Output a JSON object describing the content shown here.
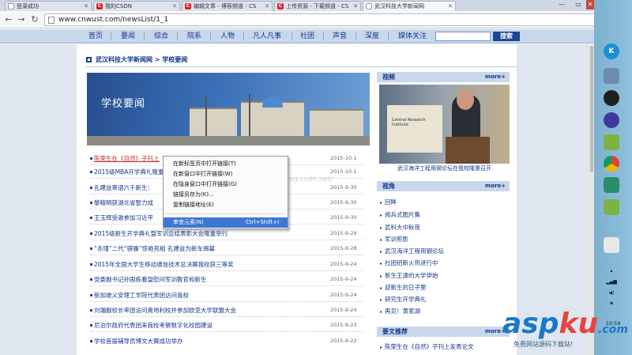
{
  "browser": {
    "tabs": [
      {
        "label": "登录成功",
        "icon": "page-icon"
      },
      {
        "label": "我的CSDN",
        "icon": "csdn-icon"
      },
      {
        "label": "编辑文章 - 博客频道 - CS",
        "icon": "csdn-icon"
      },
      {
        "label": "上传资源 - 下载频道 - CS",
        "icon": "csdn-icon"
      },
      {
        "label": "武汉科技大学新闻网",
        "icon": "page-icon"
      }
    ],
    "active_tab_index": 4,
    "window_buttons": {
      "minimize": "—",
      "maximize": "▭",
      "close": "✕"
    },
    "url": "www.cnwust.com/newsList/1_1"
  },
  "site_nav": {
    "items": [
      "首页",
      "要闻",
      "综合",
      "院系",
      "人物",
      "凡人凡事",
      "社团",
      "声音",
      "深度",
      "媒体关注"
    ],
    "search_placeholder": "",
    "search_button": "搜索"
  },
  "breadcrumb": {
    "site": "武汉科技大学新闻网",
    "sep": " > ",
    "section": "学校要闻"
  },
  "banner": {
    "title": "学校要闻"
  },
  "news": [
    {
      "title": "陈荣生在《自然》子刊上",
      "date": "2015-10-1"
    },
    {
      "title": "2015级MBA开学典礼隆重",
      "date": "2015-10-1"
    },
    {
      "title": "孔建益寄语六千新生：",
      "date": "2015-9-30"
    },
    {
      "title": "黎精明获湖北省智力成",
      "date": "2015-9-30"
    },
    {
      "title": "王玉辉受邀参加习近平",
      "date": "2015-9-30"
    },
    {
      "title": "2015级新生开学典礼暨军训总结表彰大会隆重举行",
      "date": "2015-9-29"
    },
    {
      "title": "“赤瑾”二代“骐骥”惊艳亮相 孔建益为新车揭幕",
      "date": "2015-9-28"
    },
    {
      "title": "2015年全国大学生移动通信技术总决赛我校获三等奖",
      "date": "2015-9-24"
    },
    {
      "title": "党委副书记孙国栋看望慰问军训教官和新生",
      "date": "2015-9-24"
    },
    {
      "title": "新加坡义安理工学院代表团访问我校",
      "date": "2015-9-24"
    },
    {
      "title": "刘瀚副校长率团访问奥地利校并参加欧亚大学联盟大会",
      "date": "2015-9-24"
    },
    {
      "title": "尼泊尔政府代表团来我校考察数字化校园建设",
      "date": "2015-9-23"
    },
    {
      "title": "学校首届辅导员博文大赛成功举办",
      "date": "2015-9-22"
    }
  ],
  "context_menu": {
    "items": [
      {
        "label": "在新标签页中打开链接(T)",
        "shortcut": ""
      },
      {
        "label": "在新窗口中打开链接(W)",
        "shortcut": ""
      },
      {
        "label": "在隐身窗口中打开链接(G)",
        "shortcut": ""
      },
      {
        "label": "链接另存为(K)...",
        "shortcut": ""
      },
      {
        "label": "复制链接地址(E)",
        "shortcut": ""
      },
      {
        "label": "审查元素(N)",
        "shortcut": "Ctrl+Shift+I"
      }
    ],
    "highlighted_index": 5
  },
  "watermark": "http://blog.csdn.net/",
  "sidebar": {
    "video": {
      "heading": "视频",
      "more": "more+",
      "screen_text": "Central Research Institute",
      "caption": "武汉海洋工程用钢论坛在我校隆重召开"
    },
    "perspective": {
      "heading": "视角",
      "more": "more+",
      "items": [
        "回眸",
        "阅兵式图片集",
        "武科大中秋夜",
        "军训剪影",
        "武汉海洋工程用钢论坛",
        "社团招新火热进行中",
        "新生王潇的大学伊始",
        "迎新生的日子里",
        "研究生开学典礼",
        "再见！黄家湖"
      ]
    },
    "recommend": {
      "heading": "要文推荐",
      "more": "more+",
      "items": [
        "陈荣生在《自然》子刊上发表论文"
      ]
    }
  },
  "taskbar": {
    "icons": [
      "K",
      "",
      "",
      "",
      "",
      "",
      "",
      "",
      ""
    ],
    "clock": "10:59"
  },
  "overlay_logo": {
    "part1": "asp",
    "part2": "ku",
    "domain": ".com",
    "subtitle": "免费网站源码下载站!"
  },
  "colors": {
    "nav_bg": "#c8d7ec",
    "link": "#13388a",
    "highlight": "#3d77d4",
    "accent_red": "#c8262d"
  }
}
